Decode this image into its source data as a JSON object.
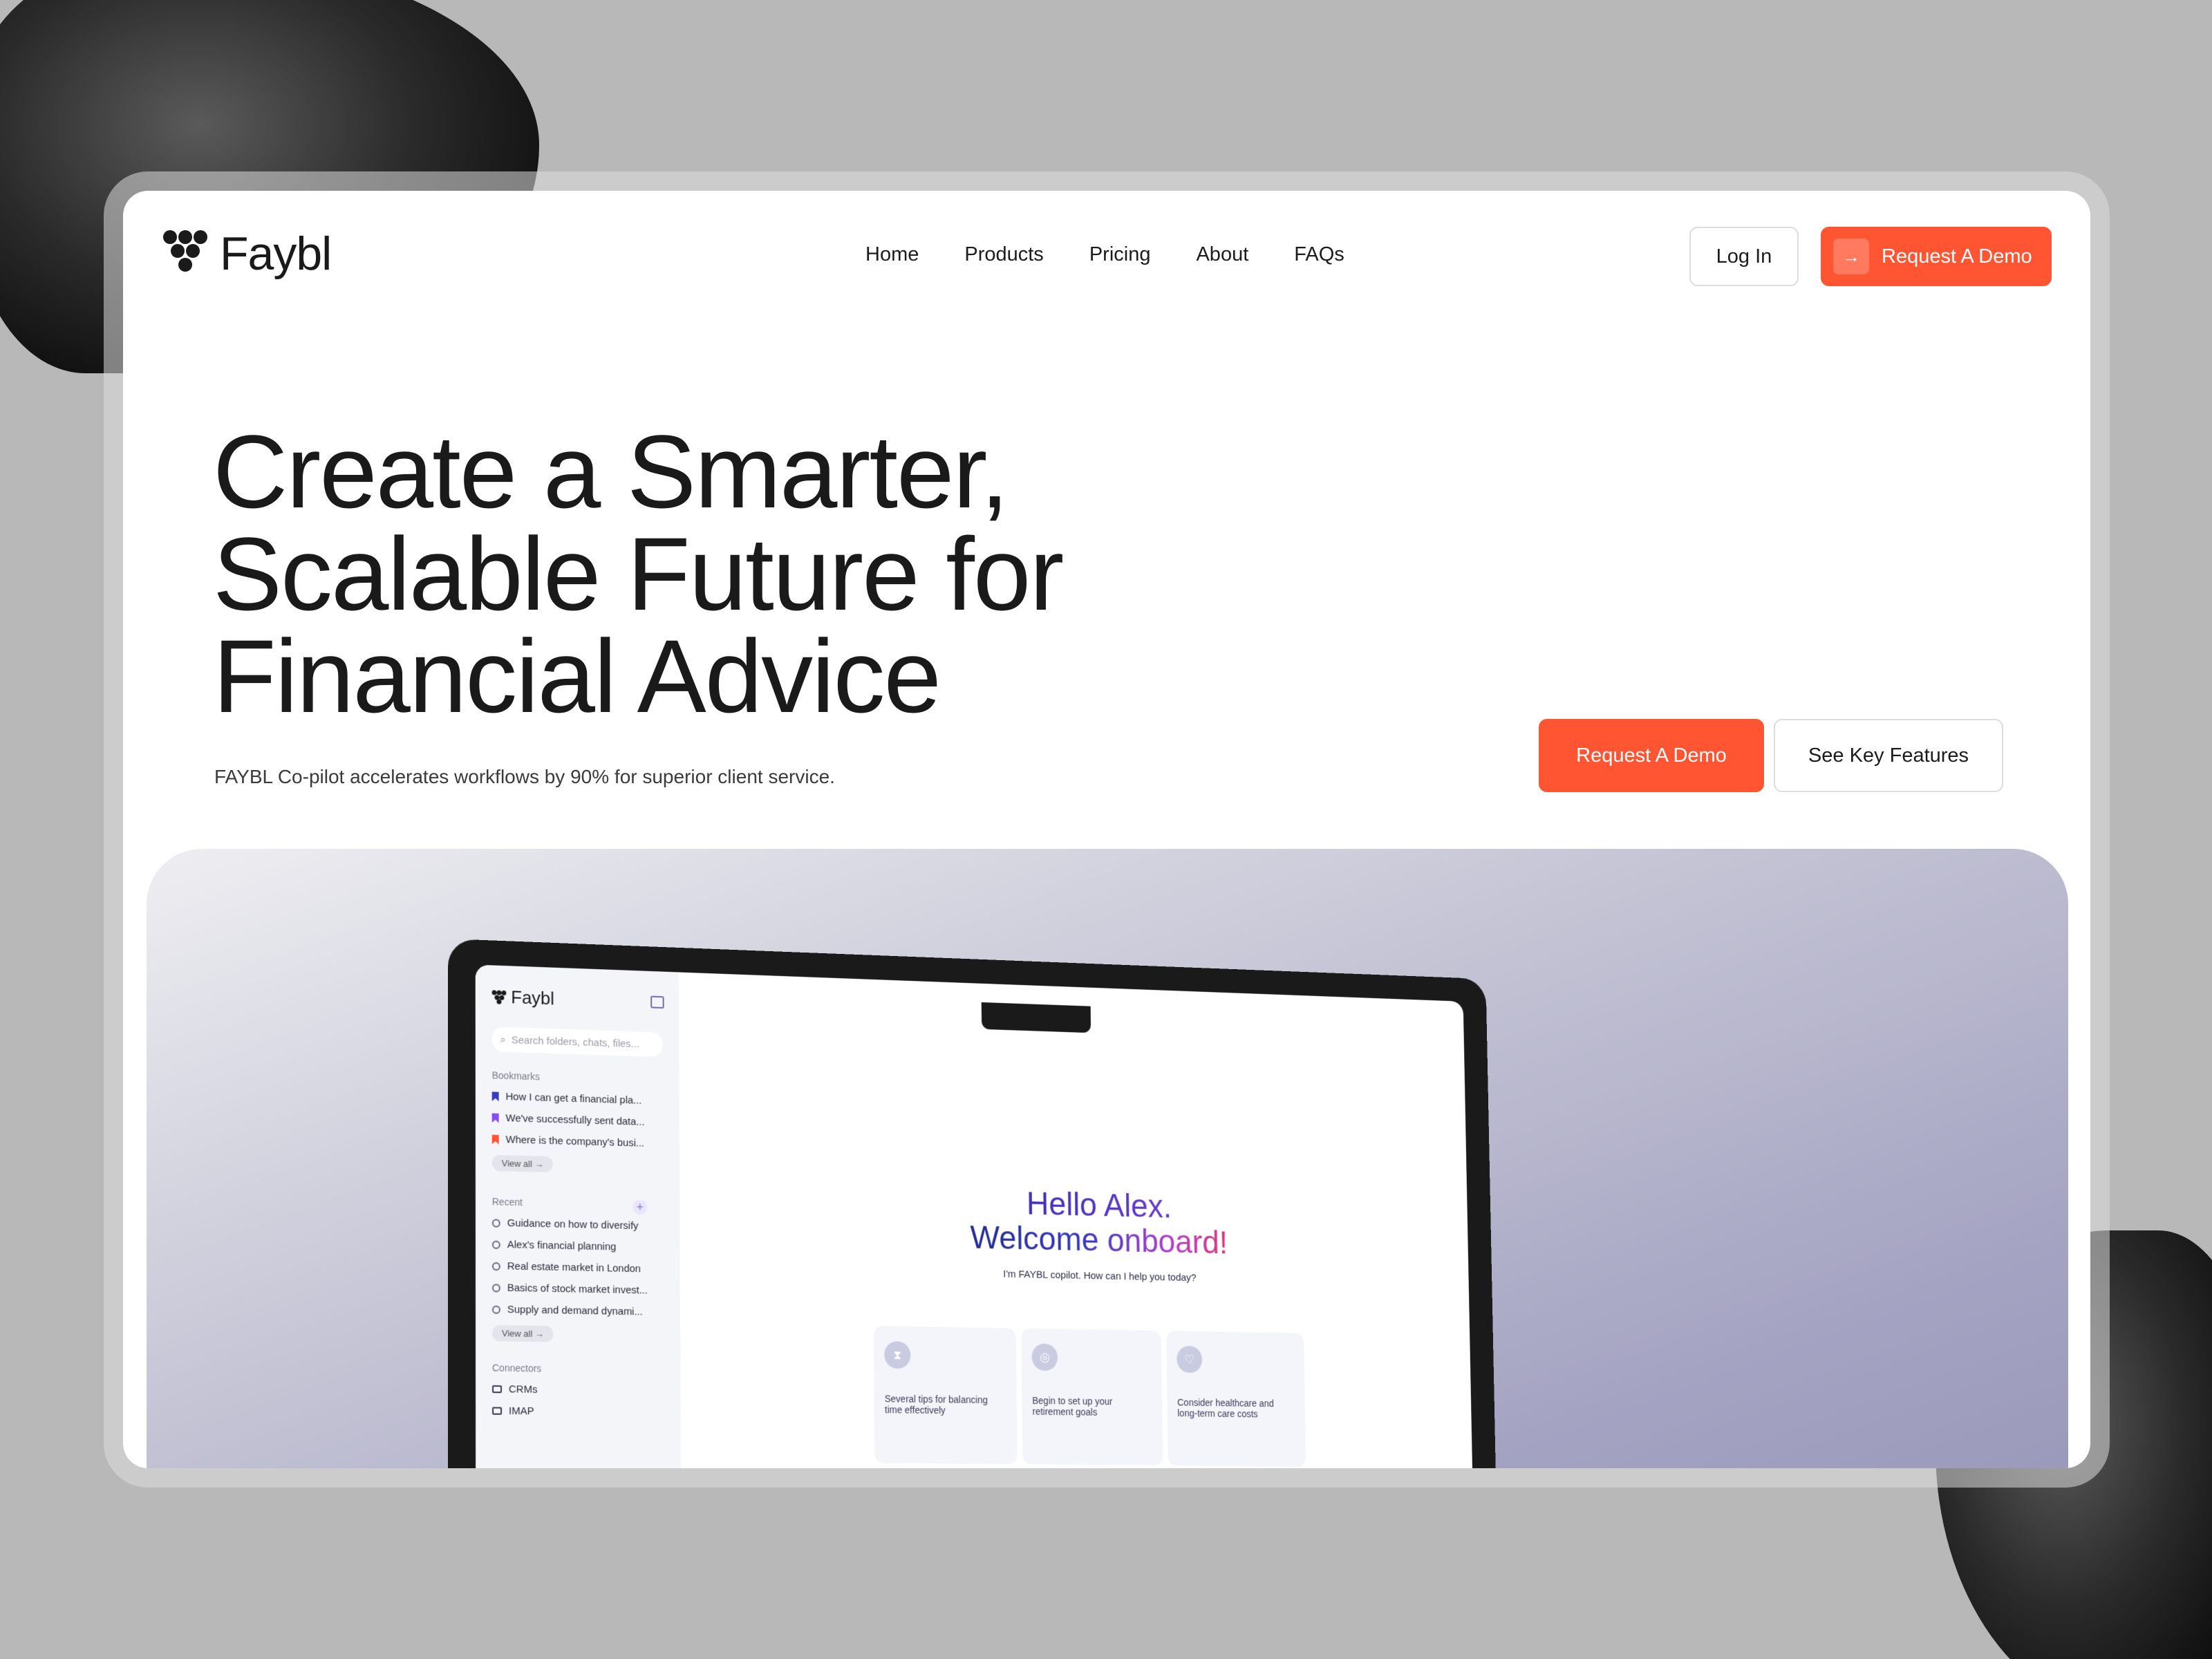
{
  "brand": {
    "name": "Faybl"
  },
  "nav": {
    "items": [
      "Home",
      "Products",
      "Pricing",
      "About",
      "FAQs"
    ]
  },
  "header": {
    "login_label": "Log In",
    "demo_label": "Request A Demo"
  },
  "hero": {
    "title_line1": "Create a Smarter,",
    "title_line2": "Scalable Future for",
    "title_line3": "Financial Advice",
    "subtitle": "FAYBL Co-pilot accelerates workflows by 90% for superior client service.",
    "cta_primary": "Request A Demo",
    "cta_secondary": "See Key Features"
  },
  "app": {
    "brand": "Faybl",
    "search_placeholder": "Search folders, chats, files...",
    "bookmarks_label": "Bookmarks",
    "bookmarks": [
      {
        "label": "How I can get a financial pla...",
        "color": "#3a3ac0"
      },
      {
        "label": "We've successfully sent data...",
        "color": "#8a4cf0"
      },
      {
        "label": "Where is the company's busi...",
        "color": "#ff5533"
      }
    ],
    "view_all": "View all",
    "recent_label": "Recent",
    "recent": [
      "Guidance on how to diversify",
      "Alex's financial planning",
      "Real estate market in London",
      "Basics of stock market invest...",
      "Supply and demand dynami..."
    ],
    "connectors_label": "Connectors",
    "connectors": [
      "CRMs",
      "IMAP"
    ],
    "greeting_line1": "Hello Alex.",
    "greeting_line2": "Welcome onboard!",
    "greeting_sub": "I'm FAYBL copilot. How can I help you today?",
    "cards": [
      "Several tips for balancing time effectively",
      "Begin to set up your retirement goals",
      "Consider healthcare and long-term care costs"
    ]
  },
  "colors": {
    "accent": "#ff5533",
    "text": "#1a1a1a",
    "background": "#b8b8b8"
  }
}
